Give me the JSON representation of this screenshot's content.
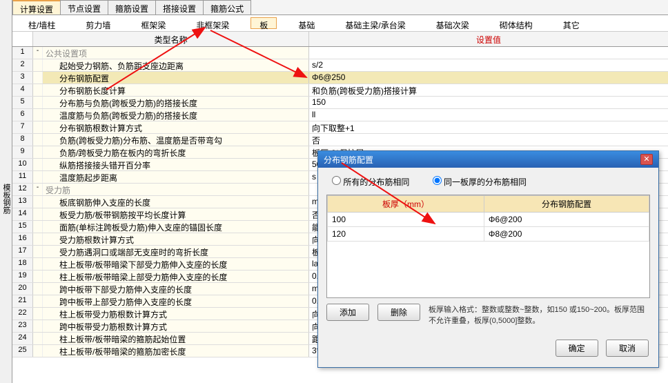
{
  "side_tab": "模板钢筋",
  "top_tabs": [
    "计算设置",
    "节点设置",
    "箍筋设置",
    "搭接设置",
    "箍筋公式"
  ],
  "top_active": 0,
  "sub_tabs": [
    "柱/墙柱",
    "剪力墙",
    "框架梁",
    "非框架梁",
    "板",
    "基础",
    "基础主梁/承台梁",
    "基础次梁",
    "砌体结构",
    "其它"
  ],
  "sub_active": 4,
  "headers": {
    "name": "类型名称",
    "value": "设置值"
  },
  "rows": [
    {
      "n": "1",
      "exp": "-",
      "name": "公共设置项",
      "val": "",
      "section": true
    },
    {
      "n": "2",
      "name": "起始受力钢筋、负筋距支座边距离",
      "val": "s/2"
    },
    {
      "n": "3",
      "name": "分布钢筋配置",
      "val": "Φ6@250",
      "sel": true
    },
    {
      "n": "4",
      "name": "分布钢筋长度计算",
      "val": "和负筋(跨板受力筋)搭接计算"
    },
    {
      "n": "5",
      "name": "分布筋与负筋(跨板受力筋)的搭接长度",
      "val": "150"
    },
    {
      "n": "6",
      "name": "温度筋与负筋(跨板受力筋)的搭接长度",
      "val": "ll"
    },
    {
      "n": "7",
      "name": "分布钢筋根数计算方式",
      "val": "向下取整+1"
    },
    {
      "n": "8",
      "name": "负筋(跨板受力筋)分布筋、温度筋是否带弯勾",
      "val": "否"
    },
    {
      "n": "9",
      "name": "负筋/跨板受力筋在板内的弯折长度",
      "val": "板厚-2*保护层"
    },
    {
      "n": "10",
      "name": "纵筋搭接接头错开百分率",
      "val": "50%"
    },
    {
      "n": "11",
      "name": "温度筋起步距离",
      "val": "s"
    },
    {
      "n": "12",
      "exp": "-",
      "name": "受力筋",
      "val": "",
      "section": true
    },
    {
      "n": "13",
      "name": "板底钢筋伸入支座的长度",
      "val": "max(ha/2,5d)"
    },
    {
      "n": "14",
      "name": "板受力筋/板带钢筋按平均长度计算",
      "val": "否"
    },
    {
      "n": "15",
      "name": "面筋(单标注跨板受力筋)伸入支座的锚固长度",
      "val": "能直锚就直锚"
    },
    {
      "n": "16",
      "name": "受力筋根数计算方式",
      "val": "向上取整+1"
    },
    {
      "n": "17",
      "name": "受力筋遇洞口或端部无支座时的弯折长度",
      "val": "板厚-2*保护层"
    },
    {
      "n": "18",
      "name": "柱上板带/板带暗梁下部受力筋伸入支座的长度",
      "val": "la"
    },
    {
      "n": "19",
      "name": "柱上板带/板带暗梁上部受力筋伸入支座的长度",
      "val": "0.6Lab+15d"
    },
    {
      "n": "20",
      "name": "跨中板带下部受力筋伸入支座的长度",
      "val": "max(ha/2,12d)"
    },
    {
      "n": "21",
      "name": "跨中板带上部受力筋伸入支座的长度",
      "val": "0.6Lab+15d"
    },
    {
      "n": "22",
      "name": "柱上板带受力筋根数计算方式",
      "val": "向上取整+1"
    },
    {
      "n": "23",
      "name": "跨中板带受力筋根数计算方式",
      "val": "向上取整+1"
    },
    {
      "n": "24",
      "name": "柱上板带/板带暗梁的箍筋起始位置",
      "val": "距柱边50mm"
    },
    {
      "n": "25",
      "name": "柱上板带/板带暗梁的箍筋加密长度",
      "val": "3*h"
    }
  ],
  "dialog": {
    "title": "分布钢筋配置",
    "radio1": "所有的分布筋相同",
    "radio2": "同一板厚的分布筋相同",
    "col1": "板厚（mm）",
    "col2": "分布钢筋配置",
    "data": [
      {
        "t": "100",
        "v": "Φ6@200"
      },
      {
        "t": "120",
        "v": "Φ8@200"
      }
    ],
    "add": "添加",
    "del": "删除",
    "hint": "板厚输入格式：整数或整数~整数，如150 或150~200。板厚范围不允许重叠，板厚(0,5000]整数。",
    "ok": "确定",
    "cancel": "取消"
  }
}
